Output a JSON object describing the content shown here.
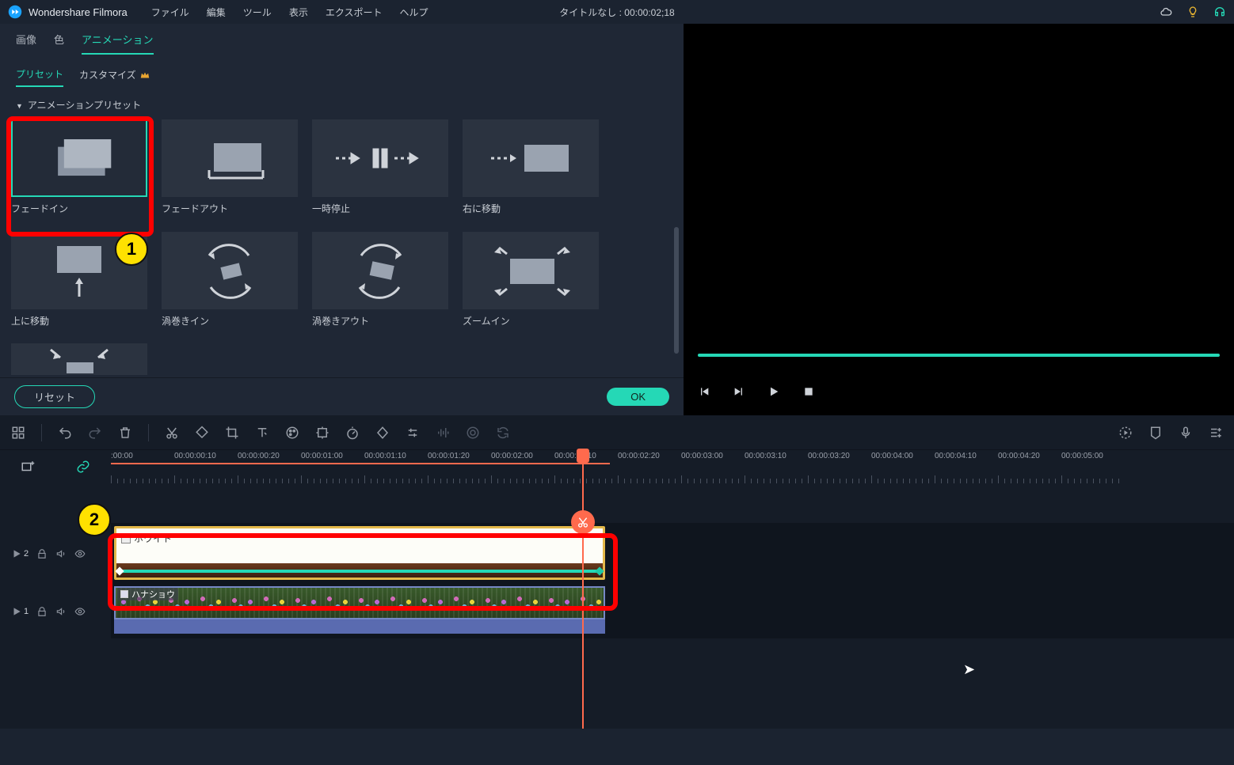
{
  "app": {
    "name": "Wondershare Filmora"
  },
  "menu": [
    "ファイル",
    "編集",
    "ツール",
    "表示",
    "エクスポート",
    "ヘルプ"
  ],
  "document_title": "タイトルなし : 00:00:02;18",
  "prop_tabs": {
    "items": [
      "画像",
      "色",
      "アニメーション"
    ],
    "active": 2
  },
  "sub_tabs": {
    "preset": "プリセット",
    "custom": "カスタマイズ",
    "active": 0
  },
  "preset_section_title": "アニメーションプリセット",
  "presets": [
    {
      "label": "フェードイン",
      "selected": true
    },
    {
      "label": "フェードアウト"
    },
    {
      "label": "一時停止"
    },
    {
      "label": "右に移動"
    },
    {
      "label": "上に移動"
    },
    {
      "label": "渦巻きイン"
    },
    {
      "label": "渦巻きアウト"
    },
    {
      "label": "ズームイン"
    }
  ],
  "buttons": {
    "reset": "リセット",
    "ok": "OK"
  },
  "annotations": {
    "badge1": "1",
    "badge2": "2"
  },
  "ruler_labels": [
    ":00:00",
    "00:00:00:10",
    "00:00:00:20",
    "00:00:01:00",
    "00:00:01:10",
    "00:00:01:20",
    "00:00:02:00",
    "00:00:02:10",
    "00:00:02:20",
    "00:00:03:00",
    "00:00:03:10",
    "00:00:03:20",
    "00:00:04:00",
    "00:00:04:10",
    "00:00:04:20",
    "00:00:05:00"
  ],
  "tracks": {
    "track2": {
      "num": "2",
      "clip_label": "ホワイト"
    },
    "track1": {
      "num": "1",
      "clip_label": "ハナショウ"
    }
  }
}
